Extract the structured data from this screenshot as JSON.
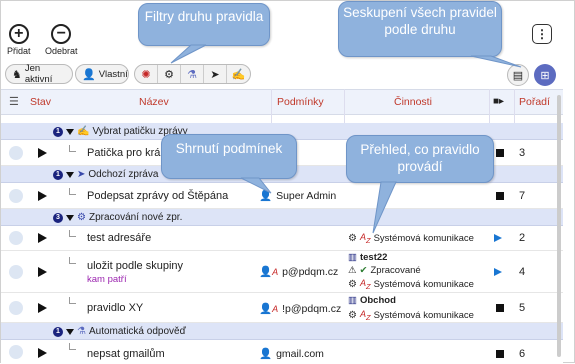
{
  "toolbar": {
    "add_label": "Přidat",
    "remove_label": "Odebrat",
    "active_only_label": "Jen aktivní",
    "own_label": "Vlastní"
  },
  "table": {
    "headers": {
      "state": "Stav",
      "name": "Název",
      "conditions": "Podmínky",
      "activities": "Činnosti",
      "order": "Pořadí"
    },
    "groups": [
      {
        "count": "1",
        "label": "Vybrat patičku zprávy"
      },
      {
        "count": "1",
        "label": "Odchozí zpráva"
      },
      {
        "count": "3",
        "label": "Zpracování nové zpr."
      },
      {
        "count": "1",
        "label": "Automatická odpověď"
      }
    ],
    "rows": [
      {
        "name": "Patička pro krá",
        "order": "3"
      },
      {
        "name": "Podepsat zprávy od Štěpána",
        "condition": "Super Admin",
        "order": "7"
      },
      {
        "name": "test adresáře",
        "activity": "Systémová komunikace",
        "order": "2"
      },
      {
        "name": "uložit podle skupiny",
        "sub": "kam patří",
        "condition": "p@pdqm.cz",
        "activity_1": "test22",
        "activity_2": "Zpracované",
        "activity_3": "Systémová komunikace",
        "order": "4"
      },
      {
        "name": "pravidlo XY",
        "condition": "!p@pdqm.cz",
        "activity_1": "Obchod",
        "activity_2": "Systémová komunikace",
        "order": "5"
      },
      {
        "name": "nepsat gmailům",
        "condition": "gmail.com",
        "order": "6"
      }
    ]
  },
  "callouts": {
    "filters": "Filtry druhu pravidla",
    "grouping": "Seskupení všech pravidel podle druhu",
    "summary": "Shrnutí podmínek",
    "overview": "Přehled, co pravidlo provádí"
  }
}
